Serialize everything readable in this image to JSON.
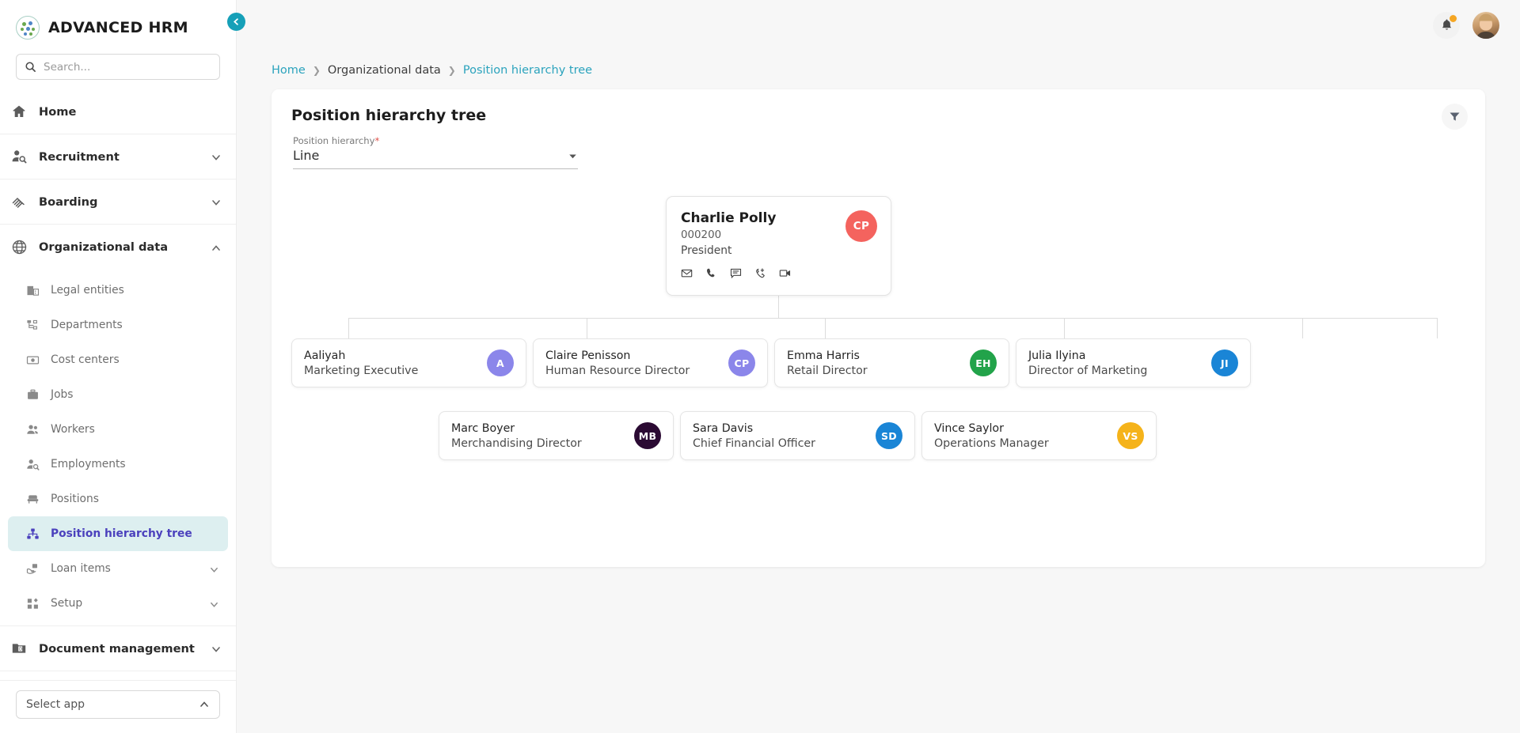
{
  "brand": {
    "title": "ADVANCED HRM",
    "logo_icon": "dots-circle-logo"
  },
  "search": {
    "placeholder": "Search...",
    "value": "",
    "icon": "search-icon"
  },
  "sidebar": {
    "items": [
      {
        "label": "Home",
        "icon": "home-icon",
        "expandable": false
      },
      {
        "label": "Recruitment",
        "icon": "person-search-icon",
        "expandable": true,
        "chevron": "chevron-down-icon"
      },
      {
        "label": "Boarding",
        "icon": "handshake-icon",
        "expandable": true,
        "chevron": "chevron-down-icon"
      },
      {
        "label": "Organizational data",
        "icon": "globe-icon",
        "expandable": true,
        "chevron": "chevron-up-icon",
        "expanded": true
      }
    ],
    "org_children": [
      {
        "label": "Legal entities",
        "icon": "building-icon",
        "active": false,
        "expandable": false
      },
      {
        "label": "Departments",
        "icon": "org-chart-icon",
        "active": false,
        "expandable": false
      },
      {
        "label": "Cost centers",
        "icon": "money-icon",
        "active": false,
        "expandable": false
      },
      {
        "label": "Jobs",
        "icon": "briefcase-icon",
        "active": false,
        "expandable": false
      },
      {
        "label": "Workers",
        "icon": "people-icon",
        "active": false,
        "expandable": false
      },
      {
        "label": "Employments",
        "icon": "person-search-icon",
        "active": false,
        "expandable": false
      },
      {
        "label": "Positions",
        "icon": "chair-icon",
        "active": false,
        "expandable": false
      },
      {
        "label": "Position hierarchy tree",
        "icon": "hierarchy-icon",
        "active": true,
        "expandable": false
      },
      {
        "label": "Loan items",
        "icon": "hand-box-icon",
        "active": false,
        "expandable": true,
        "chevron": "chevron-down-icon"
      },
      {
        "label": "Setup",
        "icon": "squares-icon",
        "active": false,
        "expandable": true,
        "chevron": "chevron-down-icon"
      }
    ],
    "items_after": [
      {
        "label": "Document management",
        "icon": "folder-doc-icon",
        "expandable": true,
        "chevron": "chevron-down-icon"
      }
    ],
    "select_app": {
      "label": "Select app",
      "chevron": "chevron-up-icon"
    },
    "collapse_button": {
      "icon": "chevron-left-icon"
    }
  },
  "topbar": {
    "notification_icon": "bell-icon",
    "notification_badge_color": "#f5a623",
    "avatar_icon": "user-avatar-photo"
  },
  "breadcrumb": [
    {
      "label": "Home",
      "link": true
    },
    {
      "label": "Organizational data",
      "link": false
    },
    {
      "label": "Position hierarchy tree",
      "link": true
    }
  ],
  "panel": {
    "title": "Position hierarchy tree",
    "filter_icon": "filter-icon",
    "field": {
      "label": "Position hierarchy",
      "required_marker": "*",
      "value": "Line",
      "chevron": "chevron-down-icon"
    }
  },
  "colors": {
    "accent_teal": "#16a0b8",
    "breadcrumb_link": "#2ba3bd",
    "active_nav_bg": "#ddeff0",
    "active_nav_text": "#4b41bd"
  },
  "tree": {
    "root": {
      "name": "Charlie Polly",
      "id": "000200",
      "role": "President",
      "initials": "CP",
      "avatar_color": "#f4635e",
      "actions": [
        {
          "icon": "email-icon"
        },
        {
          "icon": "phone-icon"
        },
        {
          "icon": "chat-icon"
        },
        {
          "icon": "phone-forward-icon"
        },
        {
          "icon": "video-icon"
        }
      ]
    },
    "row2": [
      {
        "name": "Aaliyah",
        "role": "Marketing Executive",
        "initials": "A",
        "avatar_color": "#8b86ea"
      },
      {
        "name": "Claire Penisson",
        "role": "Human Resource Director",
        "initials": "CP",
        "avatar_color": "#8b86ea"
      },
      {
        "name": "Emma Harris",
        "role": "Retail Director",
        "initials": "EH",
        "avatar_color": "#22a34a"
      },
      {
        "name": "Julia Ilyina",
        "role": "Director of Marketing",
        "initials": "JI",
        "avatar_color": "#1a85d6"
      }
    ],
    "row3": [
      {
        "name": "Marc Boyer",
        "role": "Merchandising Director",
        "initials": "MB",
        "avatar_color": "#2b0a33"
      },
      {
        "name": "Sara Davis",
        "role": "Chief Financial Officer",
        "initials": "SD",
        "avatar_color": "#1a85d6"
      },
      {
        "name": "Vince Saylor",
        "role": "Operations Manager",
        "initials": "VS",
        "avatar_color": "#f5b31a"
      }
    ]
  }
}
